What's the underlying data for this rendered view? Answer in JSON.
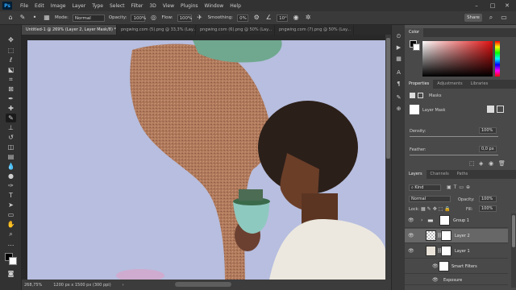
{
  "app": {
    "logo": "Ps",
    "menu": [
      "File",
      "Edit",
      "Image",
      "Layer",
      "Type",
      "Select",
      "Filter",
      "3D",
      "View",
      "Plugins",
      "Window",
      "Help"
    ],
    "window_controls": [
      "–",
      "□",
      "✕"
    ]
  },
  "options": {
    "mode_label": "Mode:",
    "mode_value": "Normal",
    "opacity_label": "Opacity:",
    "opacity_value": "100%",
    "flow_label": "Flow:",
    "flow_value": "100%",
    "smoothing_label": "Smoothing:",
    "smoothing_value": "0%",
    "angle_value": "10°",
    "share_label": "Share"
  },
  "tabs": [
    {
      "label": "Untitled-1 @ 269% (Layer 2, Layer Mask/8) *",
      "active": true
    },
    {
      "label": "pngwing.com (5).png @ 33,3% (Lay...",
      "active": false
    },
    {
      "label": "pngwing.com (6).png @ 50% (Lay...",
      "active": false
    },
    {
      "label": "pngwing.com (7).png @ 50% (Lay...",
      "active": false
    }
  ],
  "status": {
    "zoom": "268,75%",
    "doc_size": "1200 px x 1500 px (300 ppi)"
  },
  "color_panel": {
    "title": "Color"
  },
  "properties_panel": {
    "tabs": [
      "Properties",
      "Adjustments",
      "Libraries"
    ],
    "masks_label": "Masks",
    "mask_type": "Layer Mask",
    "density_label": "Density:",
    "density_value": "100%",
    "feather_label": "Feather:",
    "feather_value": "0,0 px"
  },
  "layers_panel": {
    "tabs": [
      "Layers",
      "Channels",
      "Paths"
    ],
    "kind_label": "Kind",
    "blend_mode": "Normal",
    "opacity_label": "Opacity:",
    "opacity_value": "100%",
    "lock_label": "Lock:",
    "fill_label": "Fill:",
    "fill_value": "100%",
    "layers": [
      {
        "name": "Group 1",
        "type": "group"
      },
      {
        "name": "Layer 2",
        "type": "layer",
        "selected": true
      },
      {
        "name": "Layer 1",
        "type": "smart"
      },
      {
        "name": "Smart Filters",
        "type": "filter"
      },
      {
        "name": "Exposure",
        "type": "filter-item"
      }
    ]
  },
  "colors": {
    "canvas_bg": "#b7bedf",
    "accent": "#31a8ff",
    "panel_bg": "#494949"
  }
}
